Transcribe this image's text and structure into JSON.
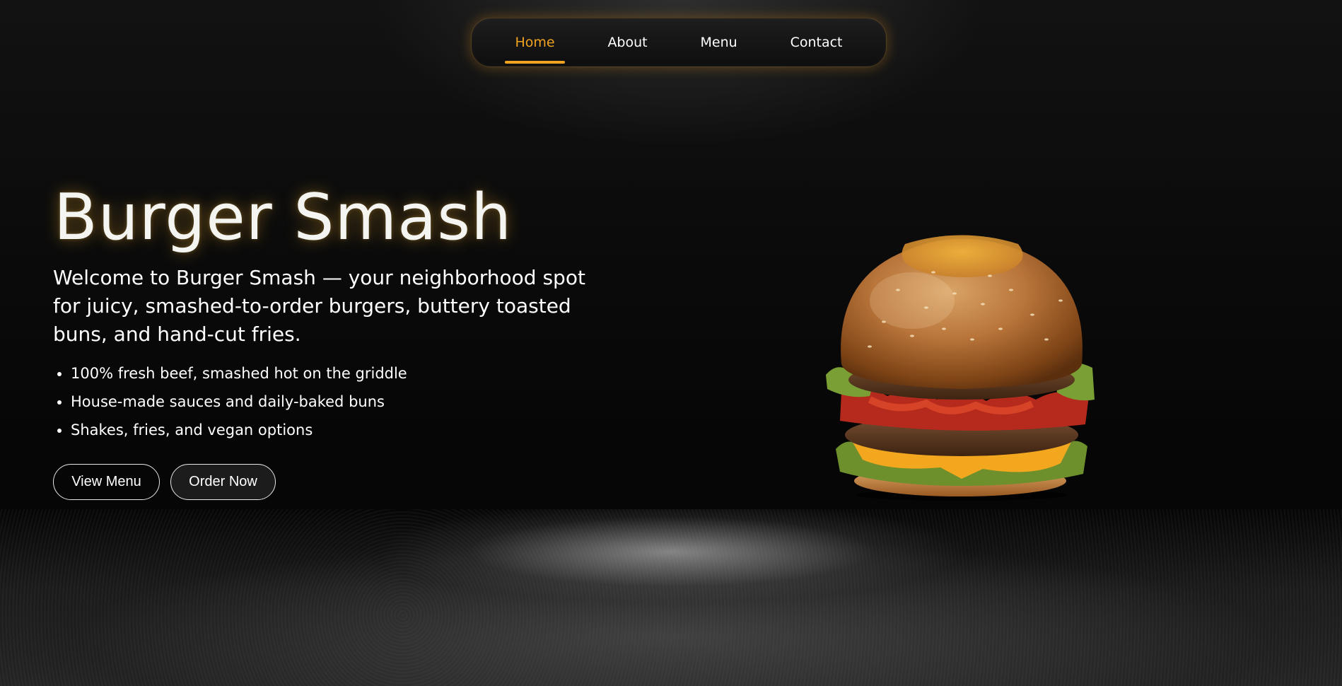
{
  "nav": {
    "items": [
      {
        "label": "Home",
        "active": true
      },
      {
        "label": "About",
        "active": false
      },
      {
        "label": "Menu",
        "active": false
      },
      {
        "label": "Contact",
        "active": false
      }
    ]
  },
  "hero": {
    "title": "Burger Smash",
    "description": "Welcome to Burger Smash — your neighborhood spot for juicy, smashed-to-order burgers, buttery toasted buns, and hand-cut fries.",
    "features": [
      "100% fresh beef, smashed hot on the griddle",
      "House-made sauces and daily-baked buns",
      "Shakes, fries, and vegan options"
    ],
    "buttons": {
      "view_menu": "View Menu",
      "order_now": "Order Now"
    }
  },
  "colors": {
    "accent": "#f0a320",
    "background": "#050505",
    "text": "#ffffff"
  },
  "images": {
    "hero_image": "burger-image"
  }
}
